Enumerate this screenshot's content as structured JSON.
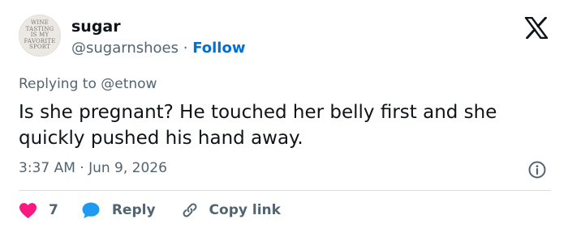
{
  "author": {
    "name": "sugar",
    "handle": "@sugarnshoes",
    "separator": "·",
    "follow_label": "Follow",
    "avatar_text": "WINE\nTASTING\nIS MY\nFAVORITE\nSPORT"
  },
  "reply_context": "Replying to @etnow",
  "tweet_text": "Is she pregnant? He touched her belly first and she quickly pushed his hand away.",
  "timestamp": "3:37 AM · Jun 9, 2026",
  "actions": {
    "like_count": "7",
    "reply_label": "Reply",
    "copy_link_label": "Copy link"
  },
  "colors": {
    "like": "#f91880",
    "reply": "#1d9bf0",
    "link": "#006fd6",
    "muted": "#536471",
    "text": "#0f1419"
  },
  "icons": [
    "x-logo-icon",
    "info-icon",
    "heart-icon",
    "reply-bubble-icon",
    "link-icon"
  ]
}
